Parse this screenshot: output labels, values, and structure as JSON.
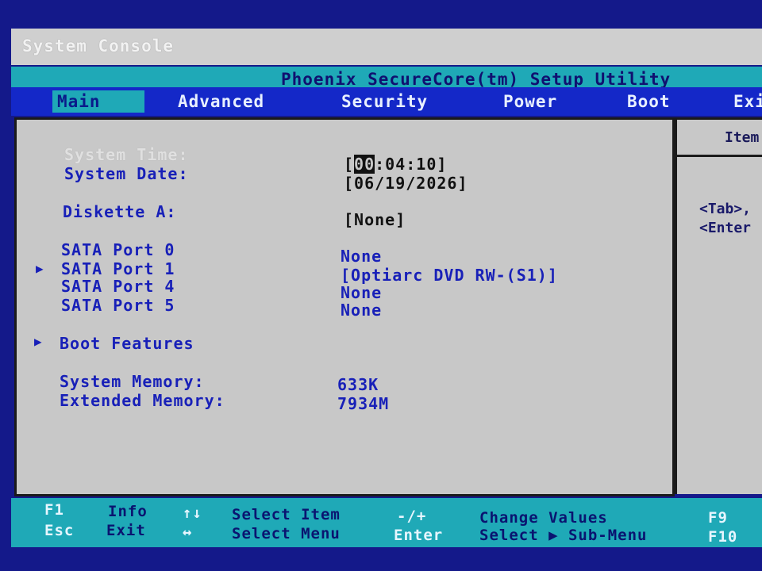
{
  "console_title": "System Console",
  "setup_title": "Phoenix SecureCore(tm) Setup Utility",
  "tabs": [
    "Main",
    "Advanced",
    "Security",
    "Power",
    "Boot",
    "Exi"
  ],
  "fields": {
    "system_time": {
      "label": "System Time:",
      "value_hour": "00",
      "value_rest": ":04:10]",
      "value_open": "["
    },
    "system_date": {
      "label": "System Date:",
      "value": "[06/19/2026]"
    },
    "diskette_a": {
      "label": "Diskette A:",
      "value": "[None]"
    },
    "sata0": {
      "label": "SATA Port 0",
      "value": "None"
    },
    "sata1": {
      "label": "SATA Port 1",
      "value": "[Optiarc DVD RW-(S1)]"
    },
    "sata4": {
      "label": "SATA Port 4",
      "value": "None"
    },
    "sata5": {
      "label": "SATA Port 5",
      "value": "None"
    },
    "boot_features": {
      "label": "Boot Features"
    },
    "system_memory": {
      "label": "System Memory:",
      "value": "633K"
    },
    "extended_memory": {
      "label": "Extended Memory:",
      "value": "7934M"
    }
  },
  "help_panel": {
    "header": "Item",
    "line1": "<Tab>,",
    "line2": "<Enter"
  },
  "footer": {
    "f1_key": "F1",
    "f1_desc": "Info",
    "esc_key": "Esc",
    "esc_desc": "Exit",
    "updown_key": "↑↓",
    "updown_desc": "Select Item",
    "leftright_key": "↔",
    "leftright_desc": "Select Menu",
    "plusminus_key": "-/+",
    "plusminus_desc": "Change Values",
    "enter_key": "Enter",
    "enter_desc": "Select ▶ Sub-Menu",
    "f9_key": "F9",
    "f10_key": "F10"
  },
  "colors": {
    "frame_blue": "#14198a",
    "teal": "#1fa9b7",
    "menu_blue": "#1428c8",
    "panel_gray": "#c8c8c8",
    "text_blue": "#1820b8"
  }
}
